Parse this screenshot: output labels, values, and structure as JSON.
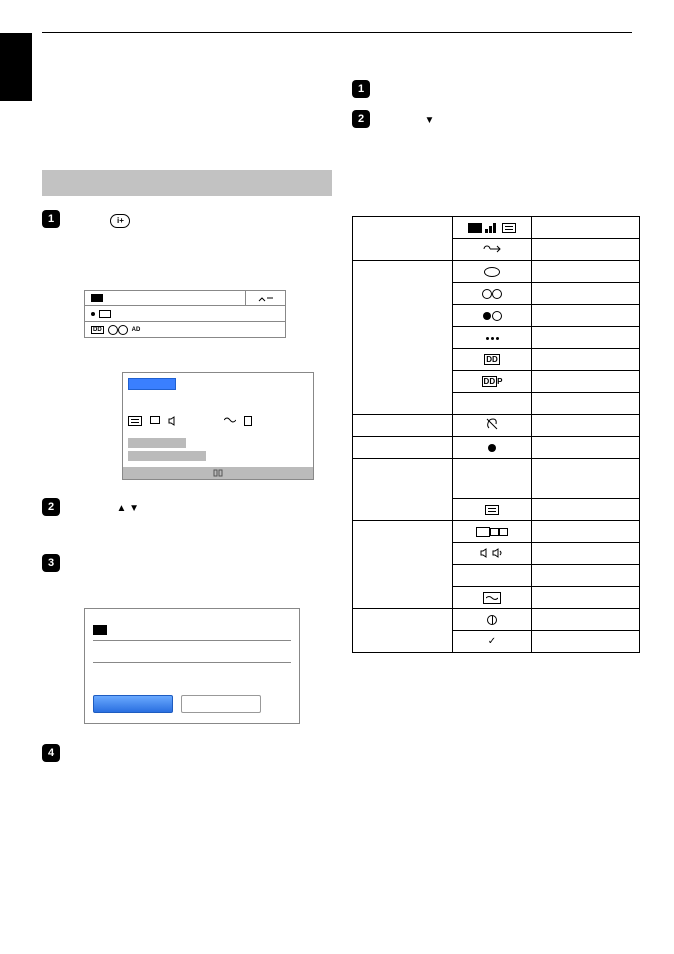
{
  "steps": {
    "s1": "1",
    "s2": "2",
    "s3": "3",
    "s4": "4"
  },
  "right_steps": {
    "s1": "1",
    "s2": "2"
  },
  "info_icon_label": "i+",
  "small_box1": {
    "ad_text": "AD"
  },
  "small_box3": {
    "rect_label": ""
  },
  "arrows": {
    "up": "▲",
    "down": "▼"
  },
  "table_icons": {
    "dd_p": "P"
  },
  "checkmark": "✓"
}
